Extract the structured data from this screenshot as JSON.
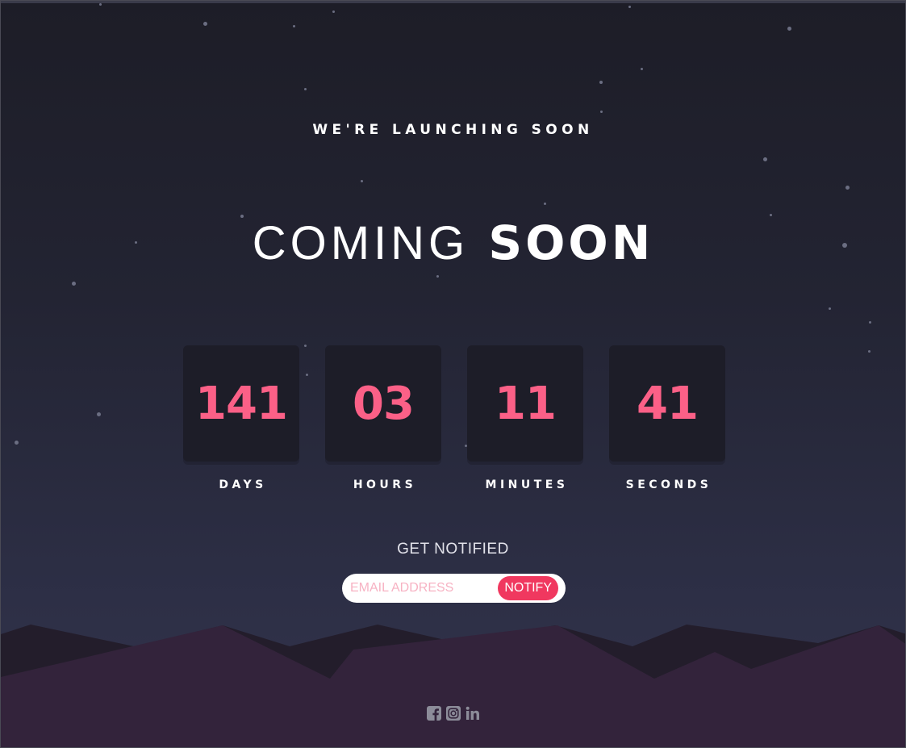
{
  "header": {
    "tagline": "WE'RE LAUNCHING SOON",
    "title_light": "COMING",
    "title_bold": "SOON"
  },
  "countdown": [
    {
      "value": "141",
      "label": "DAYS"
    },
    {
      "value": "03",
      "label": "HOURS"
    },
    {
      "value": "11",
      "label": "MINUTES"
    },
    {
      "value": "41",
      "label": "SECONDS"
    }
  ],
  "notify": {
    "heading": "GET NOTIFIED",
    "email_placeholder": "EMAIL ADDRESS",
    "email_value": "",
    "button_label": "NOTIFY"
  },
  "social": [
    {
      "icon": "facebook-icon"
    },
    {
      "icon": "instagram-icon"
    },
    {
      "icon": "linkedin-icon"
    }
  ],
  "colors": {
    "accent": "#fb6087",
    "button": "#f0385f",
    "card": "#1d1d28",
    "hills_front": "#33233b",
    "hills_back": "#231d2b",
    "icon": "#8c8c99"
  }
}
